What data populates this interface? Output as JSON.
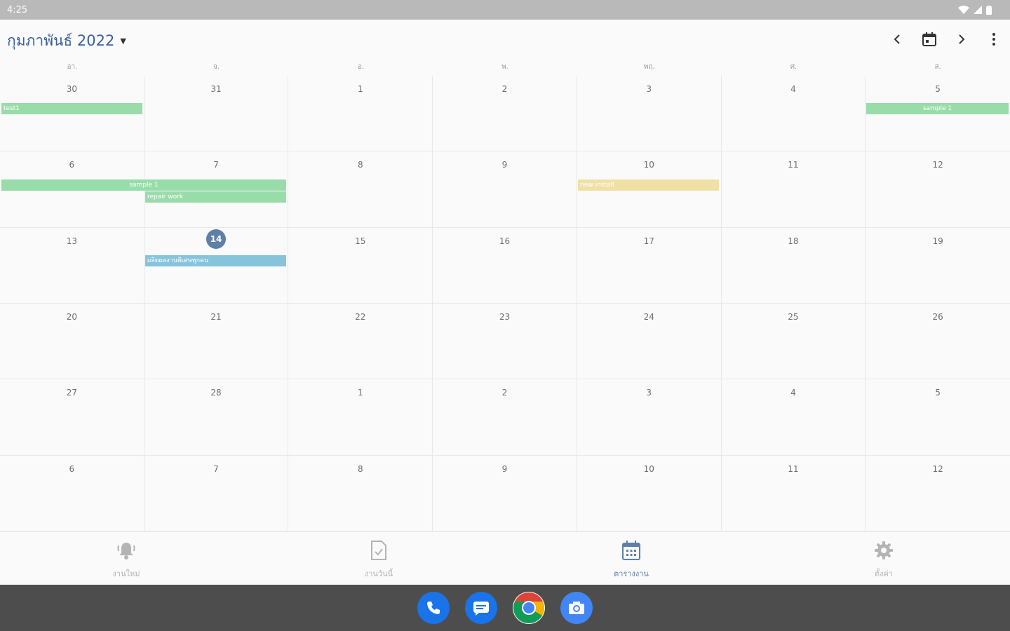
{
  "status_bar": {
    "time": "4:25"
  },
  "header": {
    "month_title": "กุมภาพันธ์ 2022"
  },
  "weekdays": [
    "อา.",
    "จ.",
    "อ.",
    "พ.",
    "พฤ.",
    "ศ.",
    "ส."
  ],
  "days": [
    "30",
    "31",
    "1",
    "2",
    "3",
    "4",
    "5",
    "6",
    "7",
    "8",
    "9",
    "10",
    "11",
    "12",
    "13",
    "14",
    "15",
    "16",
    "17",
    "18",
    "19",
    "20",
    "21",
    "22",
    "23",
    "24",
    "25",
    "26",
    "27",
    "28",
    "1",
    "2",
    "3",
    "4",
    "5",
    "6",
    "7",
    "8",
    "9",
    "10",
    "11",
    "12"
  ],
  "today": "14",
  "events": {
    "test": "test1",
    "sample_a": "sample 1",
    "sample_b": "sample 1",
    "repair": "repair work",
    "new_install": "new install",
    "promo": "ผลิตผลงานพิเศษทุกคน"
  },
  "bottom_nav": {
    "new_jobs": "งานใหม่",
    "today_jobs": "งานวันนี้",
    "schedule": "ตารางงาน",
    "settings": "ตั้งค่า"
  },
  "colors": {
    "accent": "#5f7fa6",
    "event_green": "#98dca9",
    "event_yellow": "#efe1a6",
    "event_blue": "#86c4dc"
  },
  "icons": {
    "prev": "chevron-left-icon",
    "today": "calendar-today-icon",
    "next": "chevron-right-icon",
    "more": "more-vert-icon"
  }
}
